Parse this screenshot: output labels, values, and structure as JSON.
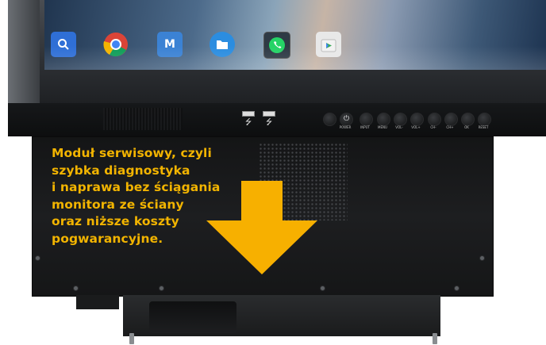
{
  "dock_apps": [
    {
      "name": "search",
      "glyph": "🔍",
      "color": "#2f6fd6"
    },
    {
      "name": "chrome",
      "glyph": "",
      "color": "#dd4b39"
    },
    {
      "name": "mail",
      "glyph": "M",
      "color": "#3b82d4"
    },
    {
      "name": "files",
      "glyph": "▮",
      "color": "#2b8de0"
    },
    {
      "name": "whatsapp",
      "glyph": "✆",
      "color": "#25a04a"
    },
    {
      "name": "play-store",
      "glyph": "▶",
      "color": "#e8e8e8"
    }
  ],
  "controls": {
    "buttons": [
      "POWER",
      "INPUT",
      "MENU",
      "VOL-",
      "VOL+",
      "CH-",
      "CH+",
      "OK",
      "RESET"
    ]
  },
  "caption": {
    "lines": [
      "Moduł serwisowy, czyli",
      "szybka diagnostyka",
      "i naprawa bez ściągania",
      "monitora ze ściany",
      "oraz niższe koszty",
      "pogwarancyjne."
    ],
    "color": "#f2b400"
  },
  "arrow": {
    "color": "#f7b000",
    "direction": "down"
  }
}
